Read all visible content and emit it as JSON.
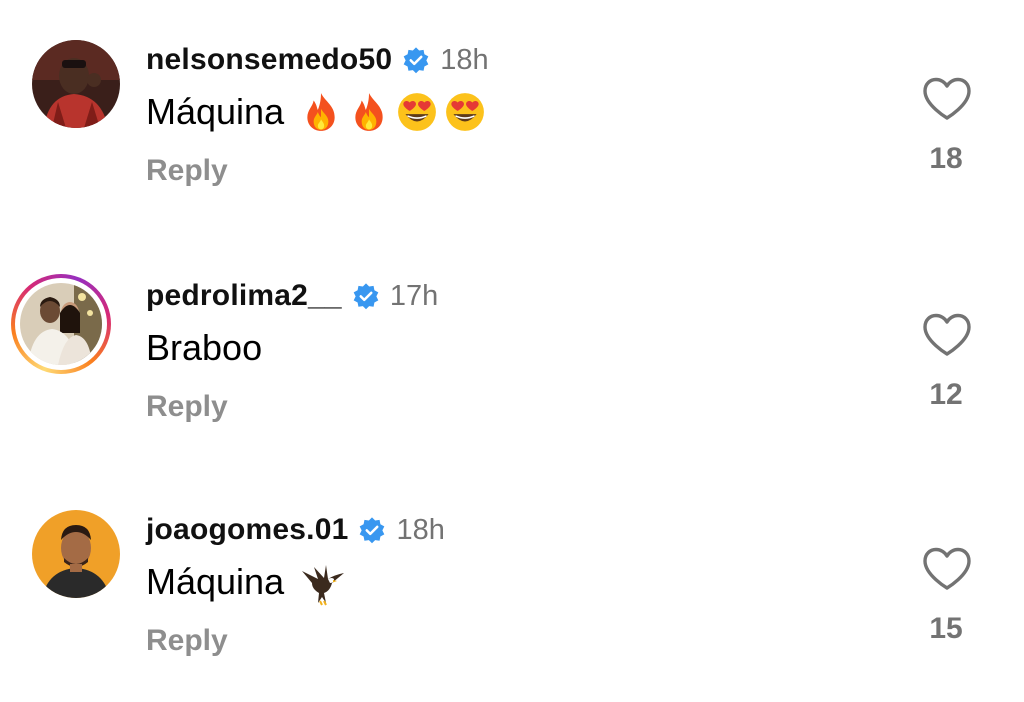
{
  "comments": [
    {
      "username": "nelsonsemedo50",
      "time": "18h",
      "text": "Máquina",
      "emojis": [
        "fire-emoji",
        "fire-emoji",
        "heart-eyes-emoji",
        "heart-eyes-emoji"
      ],
      "reply_label": "Reply",
      "likes": "18",
      "verified": true,
      "story_ring": false
    },
    {
      "username": "pedrolima2__",
      "time": "17h",
      "text": "Braboo",
      "emojis": [],
      "reply_label": "Reply",
      "likes": "12",
      "verified": true,
      "story_ring": true
    },
    {
      "username": "joaogomes.01",
      "time": "18h",
      "text": "Máquina",
      "emojis": [
        "eagle-emoji"
      ],
      "reply_label": "Reply",
      "likes": "15",
      "verified": true,
      "story_ring": false
    }
  ],
  "colors": {
    "verified_blue": "#3897f0",
    "muted_gray": "#737373",
    "reply_gray": "#8e8e8e"
  }
}
